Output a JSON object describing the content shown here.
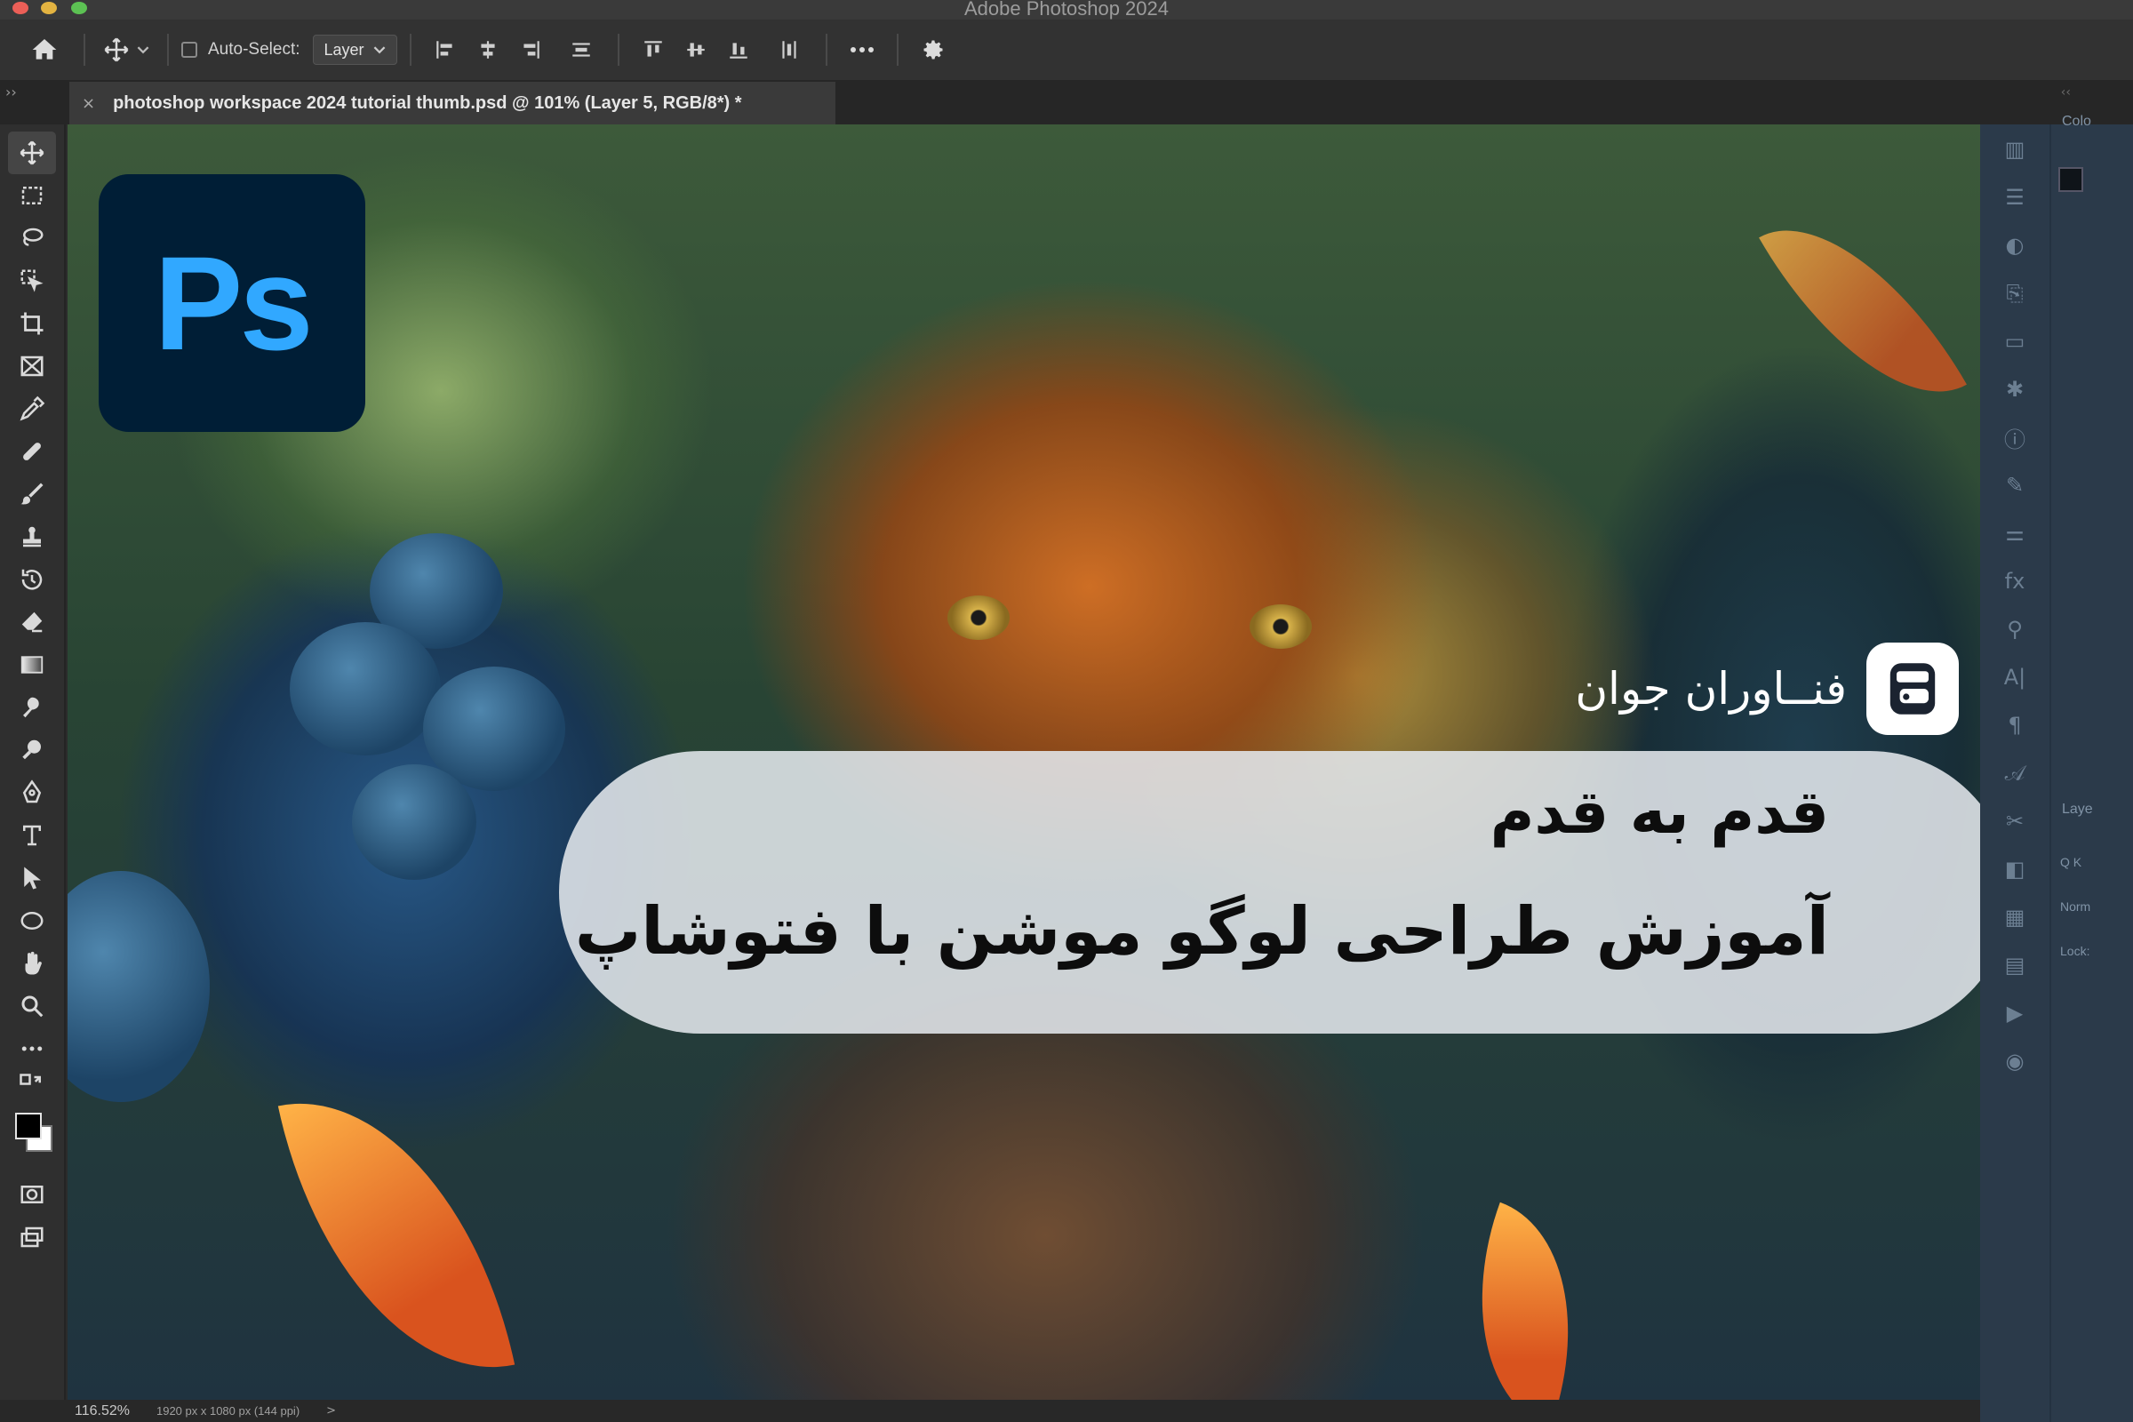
{
  "window": {
    "app_title": "Adobe Photoshop 2024"
  },
  "options_bar": {
    "auto_select_label": "Auto-Select:",
    "auto_select_value": "Layer"
  },
  "document_tab": {
    "close_glyph": "×",
    "title": "photoshop workspace 2024 tutorial thumb.psd @ 101% (Layer 5, RGB/8*) *"
  },
  "toolbar": {
    "tools": [
      "move-tool",
      "rectangular-marquee-tool",
      "lasso-tool",
      "object-selection-tool",
      "crop-tool",
      "frame-tool",
      "eyedropper-tool",
      "spot-healing-tool",
      "brush-tool",
      "clone-stamp-tool",
      "history-brush-tool",
      "eraser-tool",
      "gradient-tool",
      "smudge-tool",
      "dodge-tool",
      "pen-tool",
      "type-tool",
      "path-selection-tool",
      "ellipse-tool",
      "hand-tool",
      "zoom-tool",
      "more-tools"
    ],
    "foreground_color": "#000000",
    "background_color": "#ffffff"
  },
  "canvas": {
    "ps_logo_text": "Ps",
    "brand_name": "فنــاوران جوان",
    "headline_line1": "قدم به قدم",
    "headline_line2": "آموزش طراحی لوگو موشن با فتوشاپ",
    "colors": {
      "ps_logo_bg": "#001e36",
      "ps_logo_text": "#31a8ff"
    }
  },
  "right_panel": {
    "color_label": "Colo",
    "layers_label": "Laye",
    "search_placeholder": "Q K",
    "blend_mode": "Norm",
    "lock_label": "Lock:",
    "fx_label": "fx"
  },
  "status_bar": {
    "zoom": "116.52%",
    "doc_info": "1920 px x 1080 px (144 ppi)",
    "arrow": ">"
  }
}
